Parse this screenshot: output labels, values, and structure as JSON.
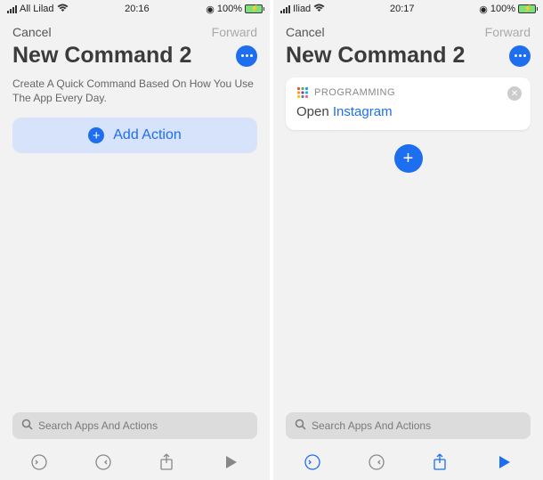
{
  "screens": [
    {
      "status": {
        "carrier": "All Lilad",
        "time": "20:16",
        "battery": "100%"
      },
      "nav": {
        "cancel": "Cancel",
        "forward": "Forward"
      },
      "title": "New Command 2",
      "description": "Create A Quick Command Based On How You Use The App Every Day.",
      "addAction": "Add Action",
      "search": {
        "placeholder": "Search Apps And Actions"
      }
    },
    {
      "status": {
        "carrier": "Iliad",
        "time": "20:17",
        "battery": "100%"
      },
      "nav": {
        "cancel": "Cancel",
        "forward": "Forward"
      },
      "title": "New Command 2",
      "card": {
        "category": "PROGRAMMING",
        "actionPrefix": "Open",
        "actionTarget": "Instagram"
      },
      "search": {
        "placeholder": "Search Apps And Actions"
      }
    }
  ]
}
